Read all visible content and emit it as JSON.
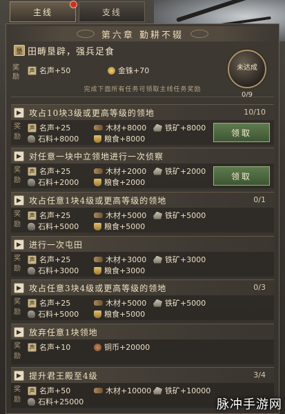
{
  "tabs": [
    {
      "label": "主线",
      "active": true,
      "has_alert": true
    },
    {
      "label": "支线",
      "active": false,
      "has_alert": false
    }
  ],
  "chapter": {
    "title": "第六章  勤耕不辍",
    "task": "田畴垦辟，强兵足食",
    "reward_label": "奖励",
    "rewards": [
      {
        "icon": "fame-icon",
        "text": "名声+50"
      },
      {
        "icon": "gold-icon",
        "text": "金铢+70"
      }
    ],
    "hint": "完成下面所有任务可领取主线任务奖励",
    "badge_label": "未达成",
    "progress": "0/9"
  },
  "tasks": [
    {
      "title": "攻占10块3级或更高等级的领地",
      "progress": "10/10",
      "claim": "领取",
      "rewards": [
        [
          "名声+25",
          "木材+8000",
          "铁矿+8000"
        ],
        [
          "石料+8000",
          "粮食+8000"
        ]
      ]
    },
    {
      "title": "对任意一块中立领地进行一次侦察",
      "progress": "",
      "claim": "领取",
      "rewards": [
        [
          "名声+25",
          "木材+2000",
          "铁矿+2000"
        ],
        [
          "石料+2000",
          "粮食+2000"
        ]
      ]
    },
    {
      "title": "攻占任意1块4级或更高等级的领地",
      "progress": "0/1",
      "claim": "",
      "rewards": [
        [
          "名声+25",
          "木材+5000",
          "铁矿+5000"
        ],
        [
          "石料+5000",
          "粮食+5000"
        ]
      ]
    },
    {
      "title": "进行一次屯田",
      "progress": "",
      "claim": "",
      "rewards": [
        [
          "名声+25",
          "木材+3000",
          "铁矿+3000"
        ],
        [
          "石料+3000",
          "粮食+3000"
        ]
      ]
    },
    {
      "title": "攻占任意3块4级或更高等级的领地",
      "progress": "0/3",
      "claim": "",
      "rewards": [
        [
          "名声+25",
          "木材+5000",
          "铁矿+5000"
        ],
        [
          "石料+5000",
          "粮食+5000"
        ]
      ]
    },
    {
      "title": "放弃任意1块领地",
      "progress": "",
      "claim": "",
      "rewards": [
        [
          "名声+10",
          "铜币+20000"
        ]
      ]
    },
    {
      "title": "提升君王殿至4级",
      "progress": "3/4",
      "claim": "",
      "rewards": [
        [
          "名声+50",
          "木材+10000",
          "铁矿+10000"
        ],
        [
          "石料+25000"
        ]
      ]
    }
  ],
  "reward_label": "奖励",
  "watermark": "脉冲手游网"
}
